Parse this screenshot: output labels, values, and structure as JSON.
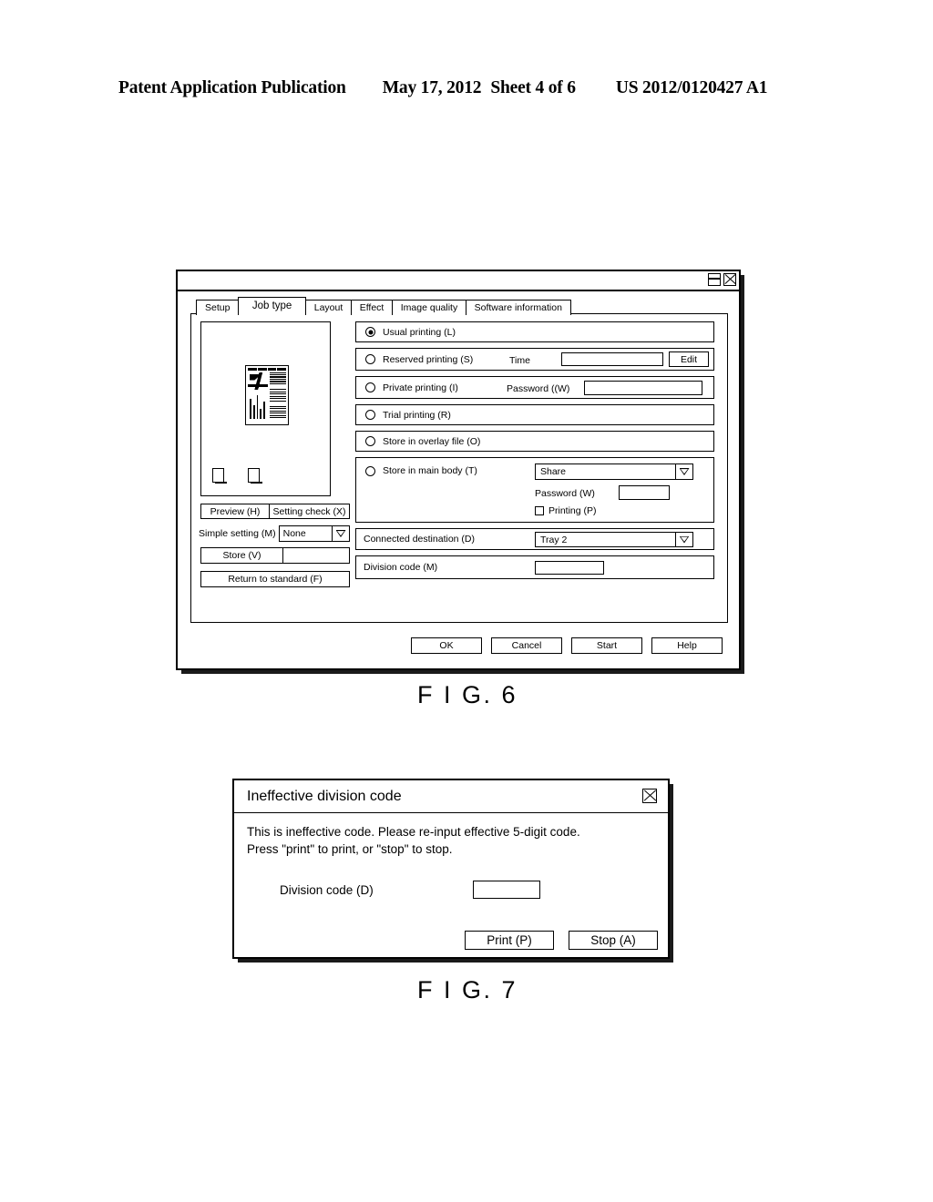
{
  "patent_header": {
    "publication": "Patent Application Publication",
    "date": "May 17, 2012",
    "sheet": "Sheet 4 of 6",
    "number": "US 2012/0120427 A1"
  },
  "figures": {
    "fig6_caption": "F I G. 6",
    "fig7_caption": "F I G. 7"
  },
  "fig6": {
    "titlebar": {
      "restore_icon": "restore-icon",
      "close_icon": "close-icon"
    },
    "tabs": [
      {
        "label": "Setup",
        "active": false
      },
      {
        "label": "Job type",
        "active": true
      },
      {
        "label": "Layout",
        "active": false
      },
      {
        "label": "Effect",
        "active": false
      },
      {
        "label": "Image quality",
        "active": false
      },
      {
        "label": "Software information",
        "active": false
      }
    ],
    "left_panel": {
      "preview_button": "Preview (H)",
      "setting_check_button": "Setting check (X)",
      "simple_setting_label": "Simple setting (M)",
      "simple_setting_value": "None",
      "store_button": "Store (V)",
      "store_field_value": "",
      "return_button": "Return to standard (F)"
    },
    "job_type_options": [
      {
        "label": "Usual printing (L)",
        "selected": true
      },
      {
        "label": "Reserved printing (S)",
        "selected": false
      },
      {
        "label": "Private printing (I)",
        "selected": false
      },
      {
        "label": "Trial printing (R)",
        "selected": false
      },
      {
        "label": "Store in overlay file (O)",
        "selected": false
      },
      {
        "label": "Store in main body (T)",
        "selected": false
      }
    ],
    "reserved": {
      "time_label": "Time",
      "time_value": "",
      "edit_button": "Edit"
    },
    "private": {
      "password_label": "Password ((W)",
      "password_value": ""
    },
    "main_body": {
      "share_value": "Share",
      "password_label": "Password (W)",
      "password_value": "",
      "printing_checkbox_label": "Printing (P)",
      "printing_checked": false
    },
    "connected_destination": {
      "label": "Connected destination (D)",
      "value": "Tray 2"
    },
    "division_code": {
      "label": "Division code (M)",
      "value": ""
    },
    "actions": {
      "ok": "OK",
      "cancel": "Cancel",
      "start": "Start",
      "help": "Help"
    }
  },
  "fig7": {
    "title": "Ineffective division code",
    "close_icon": "close-icon",
    "message": "This is ineffective code. Please re-input effective 5-digit code.\nPress \"print\" to print, or \"stop\" to stop.",
    "code_label": "Division code (D)",
    "code_value": "",
    "print_button": "Print (P)",
    "stop_button": "Stop (A)"
  }
}
